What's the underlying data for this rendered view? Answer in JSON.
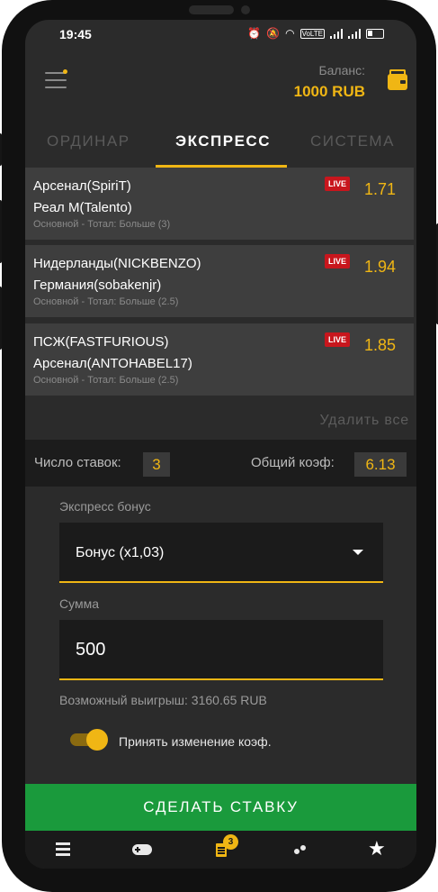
{
  "status_bar": {
    "time": "19:45",
    "volte": "VoLTE"
  },
  "header": {
    "balance_label": "Баланс:",
    "balance_value": "1000 RUB"
  },
  "tabs": [
    {
      "label": "ОРДИНАР",
      "active": false
    },
    {
      "label": "ЭКСПРЕСС",
      "active": true
    },
    {
      "label": "СИСТЕМА",
      "active": false
    }
  ],
  "bets": [
    {
      "team1": "Арсенал(SpiriT)",
      "team2": "Реал М(Talento)",
      "market": "Основной -  Тотал: Больше (3)",
      "live": "LIVE",
      "odds": "1.71"
    },
    {
      "team1": "Нидерланды(NICKBENZO)",
      "team2": "Германия(sobakenjr)",
      "market": "Основной -  Тотал: Больше (2.5)",
      "live": "LIVE",
      "odds": "1.94"
    },
    {
      "team1": "ПСЖ(FASTFURIOUS)",
      "team2": "Арсенал(ANTOHABEL17)",
      "market": "Основной -  Тотал: Больше (2.5)",
      "live": "LIVE",
      "odds": "1.85"
    }
  ],
  "delete_all": "Удалить все",
  "summary": {
    "count_label": "Число ставок:",
    "count_value": "3",
    "coef_label": "Общий коэф:",
    "coef_value": "6.13"
  },
  "form": {
    "bonus_label": "Экспресс бонус",
    "bonus_value": "Бонус (x1,03)",
    "amount_label": "Сумма",
    "amount_value": "500",
    "possible_win": "Возможный выигрыш: 3160.65 RUB",
    "accept_change_label": "Принять изменение коэф.",
    "accept_change_on": true
  },
  "submit_label": "СДЕЛАТЬ СТАВКУ",
  "bottom_nav": {
    "betslip_badge": "3"
  },
  "colors": {
    "accent": "#f0b614",
    "live": "#c8161d",
    "submit": "#1a9a3c"
  }
}
